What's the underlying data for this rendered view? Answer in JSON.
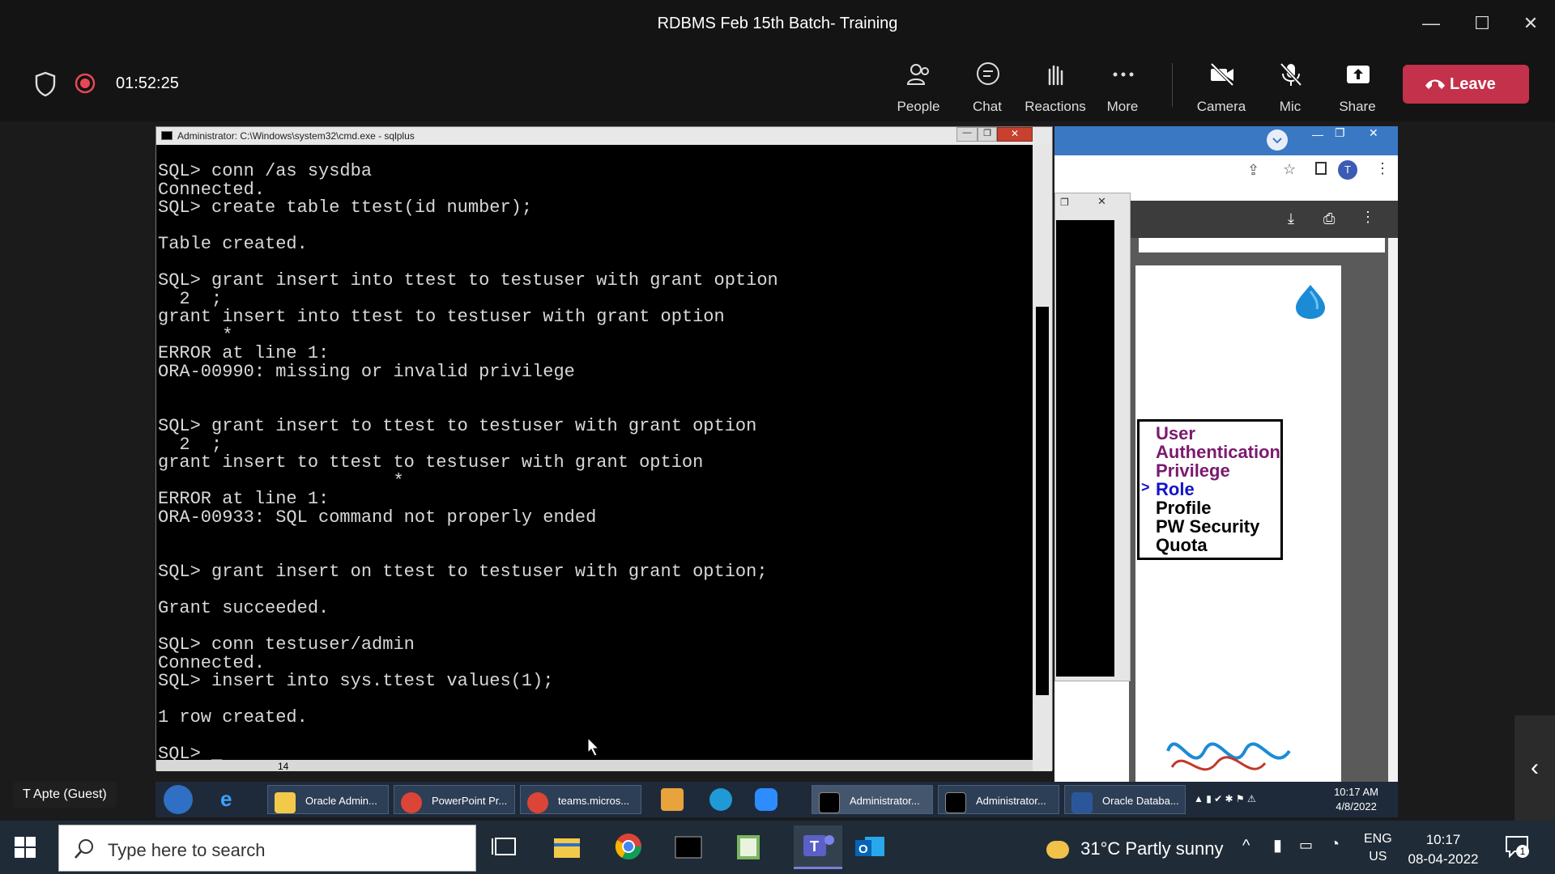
{
  "window": {
    "title": "RDBMS Feb 15th Batch- Training",
    "minimize": "—",
    "maximize": "☐",
    "close": "✕"
  },
  "meeting": {
    "timer": "01:52:25",
    "buttons": {
      "people": "People",
      "chat": "Chat",
      "reactions": "Reactions",
      "more": "More",
      "camera": "Camera",
      "mic": "Mic",
      "share": "Share",
      "leave": "Leave"
    },
    "guest_name": "T Apte (Guest)"
  },
  "cmd": {
    "title": "Administrator: C:\\Windows\\system32\\cmd.exe - sqlplus",
    "lines": [
      "SQL> conn /as sysdba",
      "Connected.",
      "SQL> create table ttest(id number);",
      "",
      "Table created.",
      "",
      "SQL> grant insert into ttest to testuser with grant option",
      "  2  ;",
      "grant insert into ttest to testuser with grant option",
      "      *",
      "ERROR at line 1:",
      "ORA-00990: missing or invalid privilege",
      "",
      "",
      "SQL> grant insert to ttest to testuser with grant option",
      "  2  ;",
      "grant insert to ttest to testuser with grant option",
      "                      *",
      "ERROR at line 1:",
      "ORA-00933: SQL command not properly ended",
      "",
      "",
      "SQL> grant insert on ttest to testuser with grant option;",
      "",
      "Grant succeeded.",
      "",
      "SQL> conn testuser/admin",
      "Connected.",
      "SQL> insert into sys.ttest values(1);",
      "",
      "1 row created.",
      "",
      "SQL> _"
    ],
    "hscroll_label": "14"
  },
  "slide": {
    "items": [
      {
        "text": "User",
        "color": "#7a1a6e"
      },
      {
        "text": "Authentication",
        "color": "#7a1a6e"
      },
      {
        "text": "Privilege",
        "color": "#7a1a6e"
      },
      {
        "text": "Role",
        "color": "#1414c8"
      },
      {
        "text": "Profile",
        "color": "#000000"
      },
      {
        "text": "PW Security",
        "color": "#000000"
      },
      {
        "text": "Quota",
        "color": "#000000"
      }
    ],
    "marker": ">"
  },
  "remote_taskbar": {
    "tasks": [
      "Oracle Admin...",
      "PowerPoint Pr...",
      "teams.micros...",
      "Administrator...",
      "Administrator...",
      "Oracle Databa..."
    ],
    "time": "10:17 AM",
    "date": "4/8/2022"
  },
  "taskbar": {
    "search_placeholder": "Type here to search",
    "weather": "31°C  Partly sunny",
    "lang1": "ENG",
    "lang2": "US",
    "time": "10:17",
    "date": "08-04-2022",
    "notifications": "1"
  },
  "colors": {
    "leave": "#c4314b",
    "toolbar_bg": "#141414",
    "taskbar_bg": "#1f2b37"
  }
}
